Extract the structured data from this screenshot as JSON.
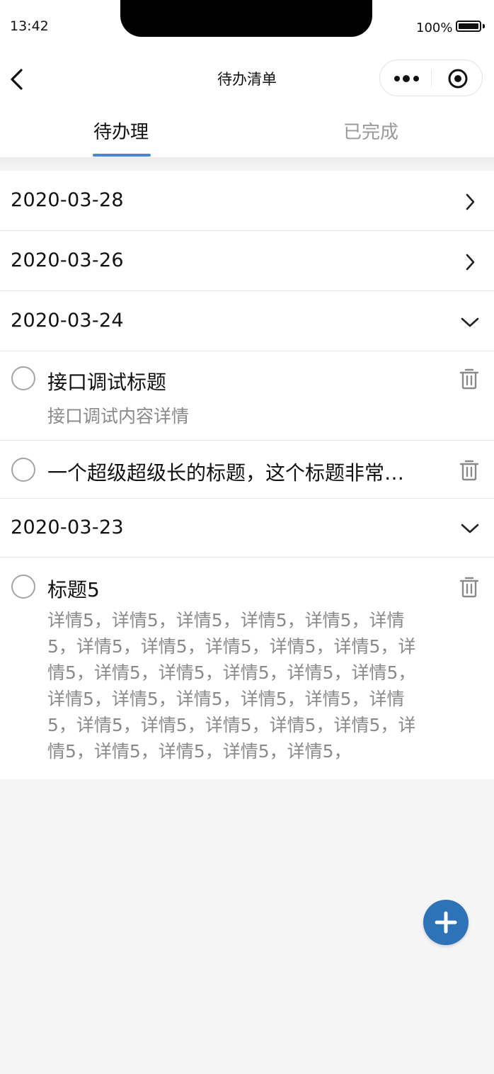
{
  "status_bar": {
    "time": "13:42",
    "battery": "100%"
  },
  "nav": {
    "title": "待办清单",
    "back_icon": "chevron-left-icon",
    "more_icon": "more-dots-icon",
    "close_icon": "record-icon"
  },
  "tabs": [
    {
      "label": "待办理",
      "active": true
    },
    {
      "label": "已完成",
      "active": false
    }
  ],
  "groups": [
    {
      "date": "2020-03-28",
      "expanded": false,
      "items": []
    },
    {
      "date": "2020-03-26",
      "expanded": false,
      "items": []
    },
    {
      "date": "2020-03-24",
      "expanded": true,
      "items": [
        {
          "title": "接口调试标题",
          "detail": "接口调试内容详情"
        },
        {
          "title": "一个超级超级长的标题，这个标题非常…",
          "detail": ""
        }
      ]
    },
    {
      "date": "2020-03-23",
      "expanded": true,
      "items": [
        {
          "title": "标题5",
          "detail": "详情5，详情5，详情5，详情5，详情5，详情5，详情5，详情5，详情5，详情5，详情5，详情5，详情5，详情5，详情5，详情5，详情5，详情5，详情5，详情5，详情5，详情5，详情5，详情5，详情5，详情5，详情5，详情5，详情5，详情5，详情5，详情5，详情5，"
        }
      ]
    }
  ],
  "fab": {
    "icon": "plus-icon"
  },
  "colors": {
    "accent": "#4a86d8",
    "fab": "#2e73b8",
    "muted": "#8a8a8a",
    "background": "#f5f5f5"
  }
}
